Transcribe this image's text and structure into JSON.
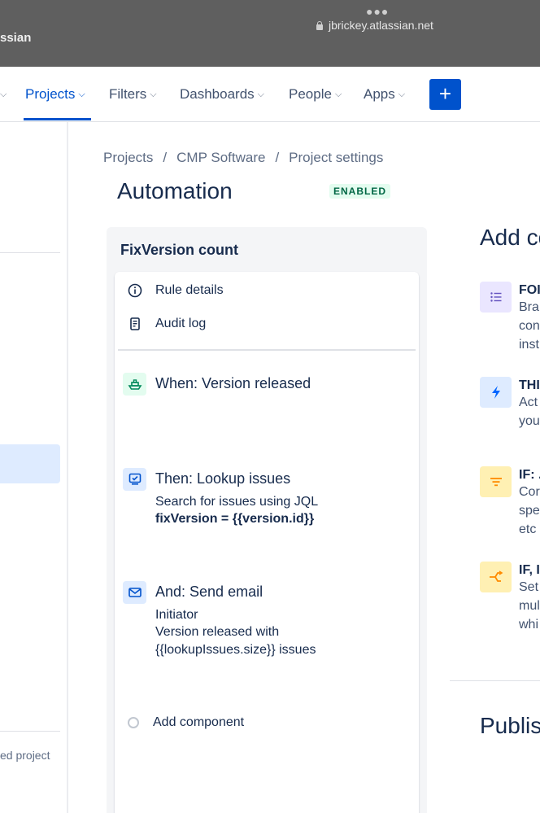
{
  "browser": {
    "url": "jbrickey.atlassian.net",
    "left_fragment": "ssian"
  },
  "nav": {
    "items": [
      {
        "label": "Projects",
        "active": true
      },
      {
        "label": "Filters"
      },
      {
        "label": "Dashboards"
      },
      {
        "label": "People"
      },
      {
        "label": "Apps"
      }
    ],
    "create_label": "+"
  },
  "sidebar": {
    "footer_text": "ed project"
  },
  "breadcrumb": [
    "Projects",
    "/",
    "CMP Software",
    "/",
    "Project settings"
  ],
  "page": {
    "title": "Automation",
    "status": "ENABLED"
  },
  "rule": {
    "name": "FixVersion count",
    "menu": [
      {
        "label": "Rule details",
        "icon": "info-icon"
      },
      {
        "label": "Audit log",
        "icon": "document-icon"
      }
    ],
    "steps": [
      {
        "title": "When: Version released",
        "icon": "ship-icon",
        "lines": []
      },
      {
        "title": "Then: Lookup issues",
        "icon": "lookup-icon",
        "lines": [
          "Search for issues using JQL"
        ],
        "bold_line": "fixVersion = {{version.id}}"
      },
      {
        "title": "And: Send email",
        "icon": "mail-icon",
        "lines": [
          "Initiator",
          "Version released with",
          "{{lookupIssues.size}} issues"
        ]
      }
    ],
    "add_component": "Add component"
  },
  "right_panel": {
    "heading": "Add co",
    "components": [
      {
        "title": "FOI",
        "desc": [
          "Bra",
          "con",
          "inst"
        ],
        "icon": "list-icon",
        "color": "#6554c0",
        "bg": "#eae6ff"
      },
      {
        "title": "THI",
        "desc": [
          "Act",
          "you"
        ],
        "icon": "lightning-icon",
        "color": "#0065ff",
        "bg": "#deebff"
      },
      {
        "title": "IF: .",
        "desc": [
          "Cor",
          "spe",
          "etc"
        ],
        "icon": "filter-icon",
        "color": "#ff8b00",
        "bg": "#fff0b3"
      },
      {
        "title": "IF, I",
        "desc": [
          "Set",
          "mul",
          "whi"
        ],
        "icon": "branch-icon",
        "color": "#ff8b00",
        "bg": "#fff0b3"
      }
    ],
    "publish_heading": "Publis"
  },
  "colors": {
    "brand_blue": "#0052cc",
    "enabled_bg": "#e3fcef",
    "enabled_text": "#006644"
  }
}
